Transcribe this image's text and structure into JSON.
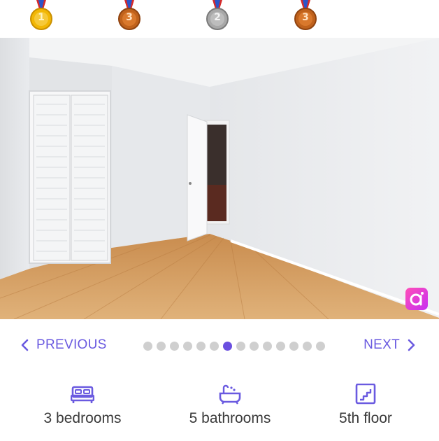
{
  "medals": [
    {
      "rank": "1",
      "tone": "gold",
      "color": "#e8a400"
    },
    {
      "rank": "3",
      "tone": "bronze",
      "color": "#c0621c"
    },
    {
      "rank": "2",
      "tone": "silver",
      "color": "#9a9a9a"
    },
    {
      "rank": "3",
      "tone": "bronze",
      "color": "#c0621c"
    }
  ],
  "photo": {
    "description_icon": "room-photo",
    "badge_icon": "brand-a-badge-icon"
  },
  "pager": {
    "previous_label": "PREVIOUS",
    "next_label": "NEXT",
    "total_slides": 14,
    "active_slide": 6
  },
  "features": {
    "bedrooms": "3 bedrooms",
    "bathrooms": "5 bathrooms",
    "floor": "5th floor"
  },
  "colors": {
    "accent": "#6a5ae0",
    "dot_inactive": "#cfcfcf",
    "dot_active": "#6a4fe0"
  }
}
